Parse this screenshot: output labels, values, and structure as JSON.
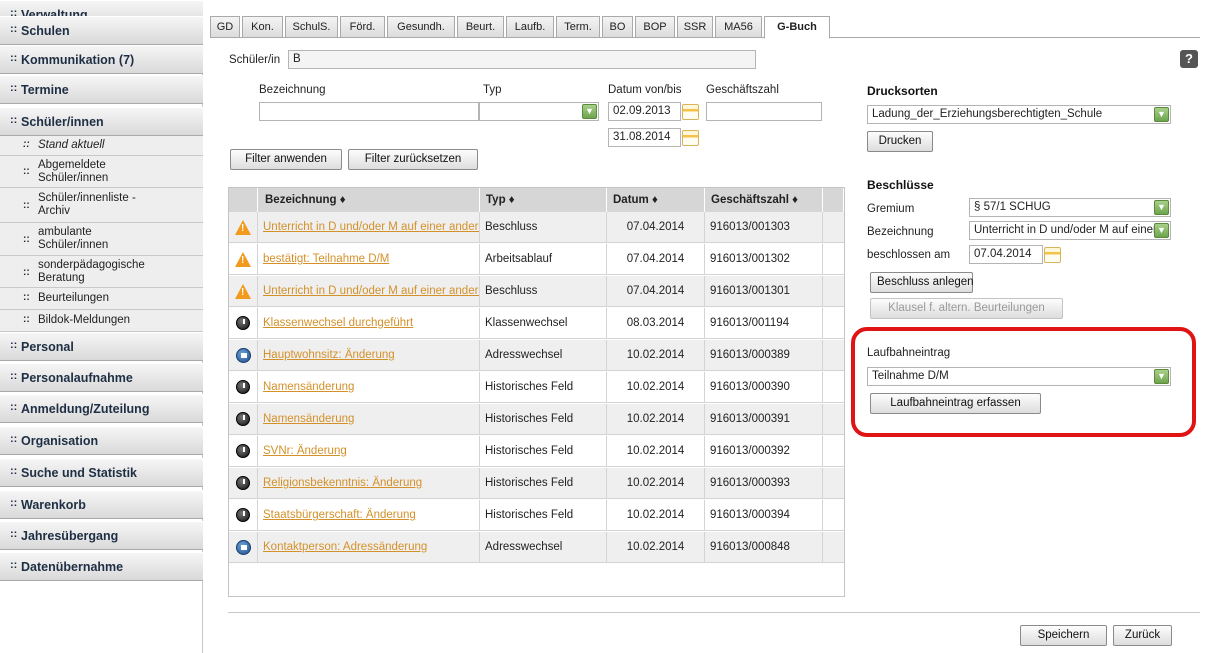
{
  "sidebar": {
    "bullet": "::",
    "items": [
      {
        "label": "Verwaltung"
      },
      {
        "label": "Schulen"
      },
      {
        "label": "Kommunikation (7)"
      },
      {
        "label": "Termine"
      },
      {
        "label": "Schüler/innen"
      },
      {
        "label": "Personal"
      },
      {
        "label": "Personalaufnahme"
      },
      {
        "label": "Anmeldung/Zuteilung"
      },
      {
        "label": "Organisation"
      },
      {
        "label": "Suche und Statistik"
      },
      {
        "label": "Warenkorb"
      },
      {
        "label": "Jahresübergang"
      },
      {
        "label": "Datenübernahme"
      }
    ],
    "sub_items": [
      {
        "line1": "Stand aktuell",
        "line2": ""
      },
      {
        "line1": "Abgemeldete",
        "line2": "Schüler/innen"
      },
      {
        "line1": "Schüler/innenliste -",
        "line2": "Archiv"
      },
      {
        "line1": "ambulante",
        "line2": "Schüler/innen"
      },
      {
        "line1": "sonderpädagogische",
        "line2": "Beratung"
      },
      {
        "line1": "Beurteilungen",
        "line2": ""
      },
      {
        "line1": "Bildok-Meldungen",
        "line2": ""
      }
    ]
  },
  "tabs": [
    "GD",
    "Kon.",
    "SchulS.",
    "Förd.",
    "Gesundh.",
    "Beurt.",
    "Laufb.",
    "Term.",
    "BO",
    "BOP",
    "SSR",
    "MA56",
    "G-Buch"
  ],
  "student": {
    "label": "Schüler/in",
    "value": "B"
  },
  "help_label": "?",
  "filter": {
    "bezeichnung_label": "Bezeichnung",
    "typ_label": "Typ",
    "datum_label": "Datum von/bis",
    "gz_label": "Geschäftszahl",
    "date_from": "02.09.2013",
    "date_to": "31.08.2014",
    "apply_btn": "Filter anwenden",
    "reset_btn": "Filter zurücksetzen"
  },
  "table": {
    "headers": [
      "Bezeichnung ♦",
      "Typ ♦",
      "Datum ♦",
      "Geschäftszahl ♦"
    ],
    "rows": [
      {
        "icon": "warning-icon",
        "bezeichnung": "Unterricht in D und/oder M auf einer anderen",
        "typ": "Beschluss",
        "datum": "07.04.2014",
        "gz": "916013/001303"
      },
      {
        "icon": "warning-icon",
        "bezeichnung": "bestätigt: Teilnahme D/M",
        "typ": "Arbeitsablauf",
        "datum": "07.04.2014",
        "gz": "916013/001302"
      },
      {
        "icon": "warning-icon",
        "bezeichnung": "Unterricht in D und/oder M auf einer anderen",
        "typ": "Beschluss",
        "datum": "07.04.2014",
        "gz": "916013/001301"
      },
      {
        "icon": "clock-icon",
        "bezeichnung": "Klassenwechsel durchgeführt",
        "typ": "Klassenwechsel",
        "datum": "08.03.2014",
        "gz": "916013/001194"
      },
      {
        "icon": "house-icon",
        "bezeichnung": "Hauptwohnsitz: Änderung",
        "typ": "Adresswechsel",
        "datum": "10.02.2014",
        "gz": "916013/000389"
      },
      {
        "icon": "clock-icon",
        "bezeichnung": "Namensänderung",
        "typ": "Historisches Feld",
        "datum": "10.02.2014",
        "gz": "916013/000390"
      },
      {
        "icon": "clock-icon",
        "bezeichnung": "Namensänderung",
        "typ": "Historisches Feld",
        "datum": "10.02.2014",
        "gz": "916013/000391"
      },
      {
        "icon": "clock-icon",
        "bezeichnung": "SVNr: Änderung",
        "typ": "Historisches Feld",
        "datum": "10.02.2014",
        "gz": "916013/000392"
      },
      {
        "icon": "clock-icon",
        "bezeichnung": "Religionsbekenntnis: Änderung",
        "typ": "Historisches Feld",
        "datum": "10.02.2014",
        "gz": "916013/000393"
      },
      {
        "icon": "clock-icon",
        "bezeichnung": "Staatsbürgerschaft: Änderung",
        "typ": "Historisches Feld",
        "datum": "10.02.2014",
        "gz": "916013/000394"
      },
      {
        "icon": "house-icon",
        "bezeichnung": "Kontaktperson: Adressänderung",
        "typ": "Adresswechsel",
        "datum": "10.02.2014",
        "gz": "916013/000848"
      }
    ]
  },
  "drucksorten": {
    "title": "Drucksorten",
    "selected": "Ladung_der_Erziehungsberechtigten_Schule",
    "print_btn": "Drucken"
  },
  "beschluesse": {
    "title": "Beschlüsse",
    "gremium_label": "Gremium",
    "gremium_value": "§ 57/1 SCHUG",
    "bezeichnung_label": "Bezeichnung",
    "bezeichnung_value": "Unterricht in D und/oder M auf einer",
    "date_label": "beschlossen am",
    "date_value": "07.04.2014",
    "create_btn": "Beschluss anlegen",
    "klausel_btn": "Klausel f. altern. Beurteilungen"
  },
  "laufbahn": {
    "title": "Laufbahneintrag",
    "selected": "Teilnahme D/M",
    "create_btn": "Laufbahneintrag erfassen"
  },
  "footer": {
    "save_btn": "Speichern",
    "back_btn": "Zurück"
  },
  "colors": {
    "accent_link": "#d4912a",
    "highlight_frame": "#e01414",
    "select_arrow": "#6ea44d"
  }
}
